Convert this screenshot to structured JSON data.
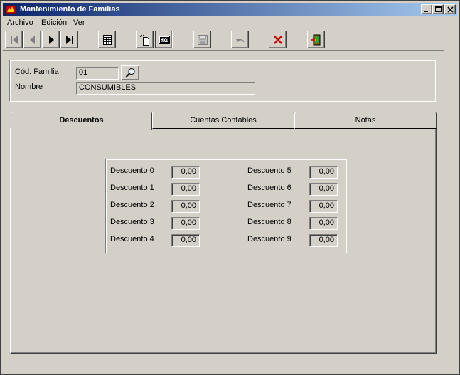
{
  "window": {
    "title": "Mantenimiento de Familias",
    "controls": [
      "minimize",
      "maximize",
      "close"
    ]
  },
  "menu": {
    "archivo": {
      "hotkey": "A",
      "rest": "rchivo"
    },
    "edicion": {
      "hotkey": "E",
      "rest": "dición"
    },
    "ver": {
      "hotkey": "V",
      "rest": "er"
    }
  },
  "toolbar": {
    "buttons": [
      "first-record",
      "previous-record",
      "next-record",
      "last-record",
      "table-view",
      "new-record",
      "edit-record",
      "save-record",
      "undo",
      "delete-record",
      "exit"
    ]
  },
  "header": {
    "cod_label": "Cód. Familia",
    "cod_value": "01",
    "nombre_label": "Nombre",
    "nombre_value": "CONSUMIBLES"
  },
  "tabs": [
    {
      "label": "Descuentos",
      "active": true
    },
    {
      "label": "Cuentas Contables",
      "active": false
    },
    {
      "label": "Notas",
      "active": false
    }
  ],
  "descuentos": [
    {
      "label": "Descuento 0",
      "value": "0,00"
    },
    {
      "label": "Descuento 1",
      "value": "0,00"
    },
    {
      "label": "Descuento 2",
      "value": "0,00"
    },
    {
      "label": "Descuento 3",
      "value": "0,00"
    },
    {
      "label": "Descuento 4",
      "value": "0,00"
    },
    {
      "label": "Descuento 5",
      "value": "0,00"
    },
    {
      "label": "Descuento 6",
      "value": "0,00"
    },
    {
      "label": "Descuento 7",
      "value": "0,00"
    },
    {
      "label": "Descuento 8",
      "value": "0,00"
    },
    {
      "label": "Descuento 9",
      "value": "0,00"
    }
  ],
  "colors": {
    "title_start": "#0a246a",
    "title_end": "#a6caf0",
    "face": "#d4d0c8",
    "delete_red": "#cc0000"
  }
}
